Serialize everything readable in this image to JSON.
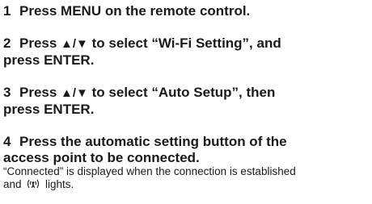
{
  "steps": [
    {
      "number": "1",
      "text": "Press MENU on the remote control."
    },
    {
      "number": "2",
      "pre": "Press ",
      "arrows": "▲/▼",
      "post_line1": " to select “Wi-Fi Setting”, and",
      "line2": "press ENTER."
    },
    {
      "number": "3",
      "pre": "Press ",
      "arrows": "▲/▼",
      "post_line1": " to select “Auto Setup”, then",
      "line2": "press ENTER."
    },
    {
      "number": "4",
      "line1": "Press the automatic setting button of the",
      "line2": "access point to be connected."
    }
  ],
  "note": {
    "line1": "“Connected” is displayed when the connection is established",
    "line2_pre": "and ",
    "icon": "wireless-lan-indicator-icon",
    "line2_post": " lights."
  }
}
